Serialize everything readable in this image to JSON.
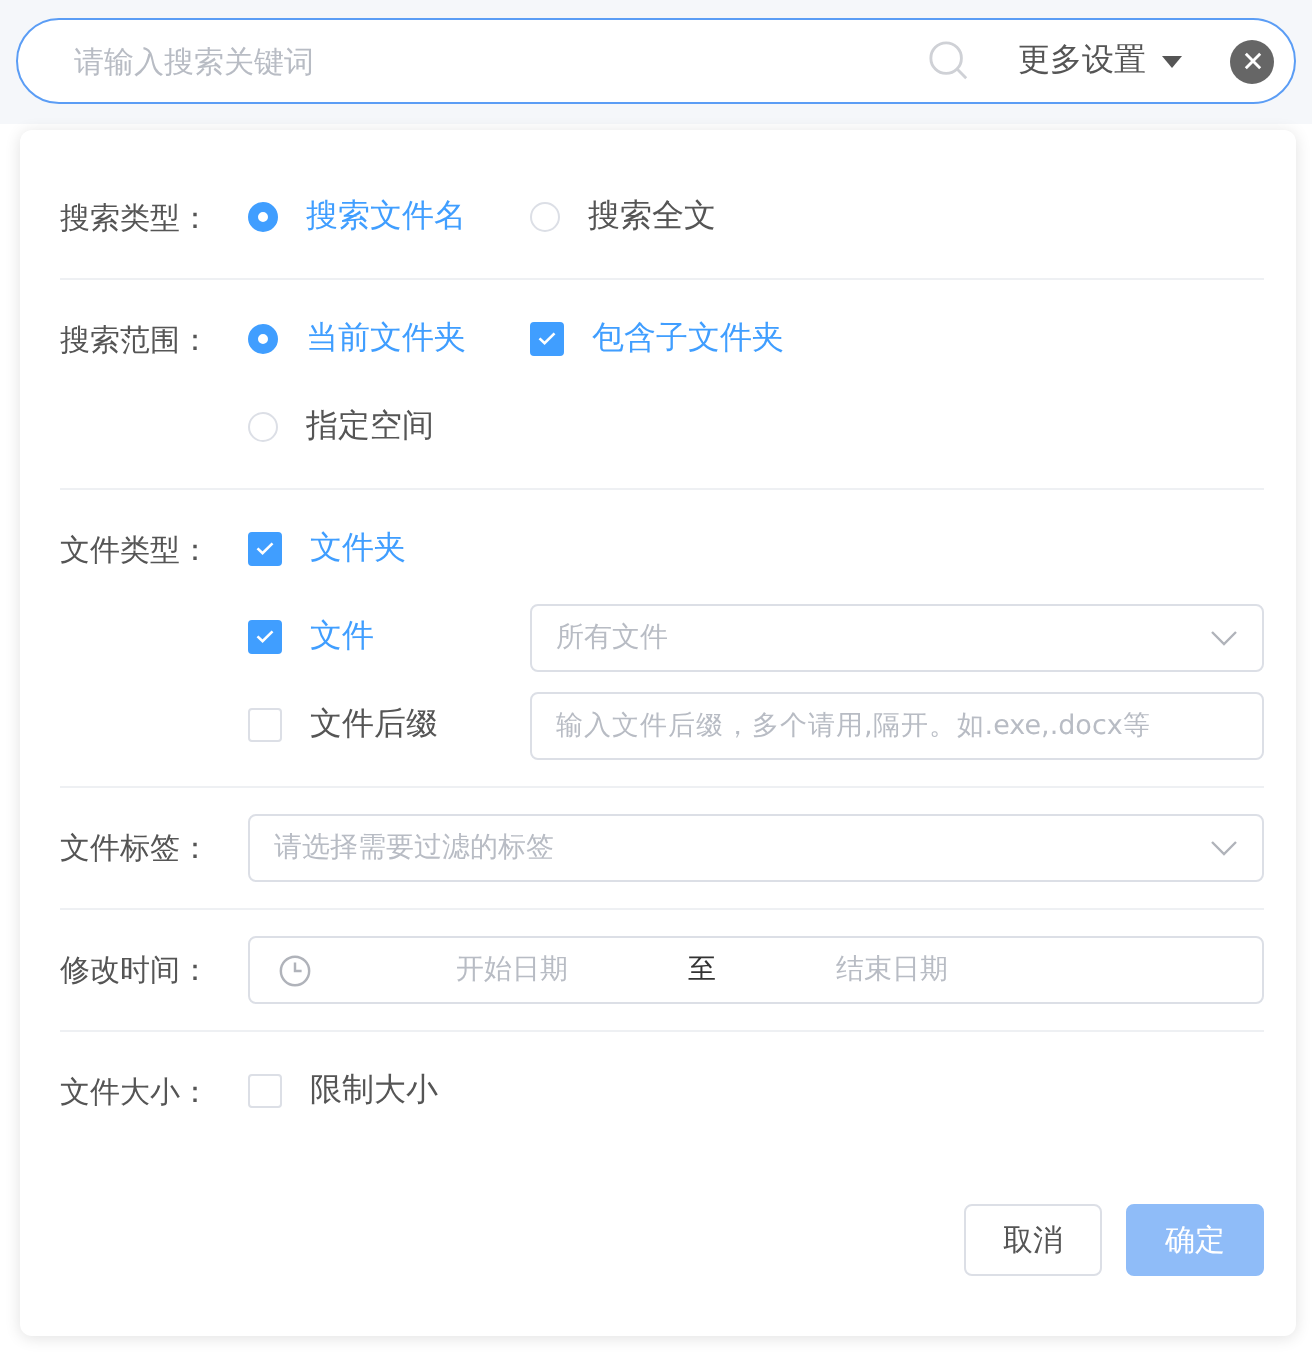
{
  "search": {
    "placeholder": "请输入搜索关键词",
    "more_settings": "更多设置"
  },
  "search_type": {
    "label": "搜索类型：",
    "options": [
      {
        "label": "搜索文件名",
        "selected": true
      },
      {
        "label": "搜索全文",
        "selected": false
      }
    ]
  },
  "search_scope": {
    "label": "搜索范围：",
    "options": [
      {
        "label": "当前文件夹",
        "selected": true
      },
      {
        "label": "指定空间",
        "selected": false
      }
    ],
    "include_subfolders": {
      "label": "包含子文件夹",
      "checked": true
    }
  },
  "file_type": {
    "label": "文件类型：",
    "items": [
      {
        "kind": "plain",
        "label": "文件夹",
        "checked": true
      },
      {
        "kind": "select",
        "label": "文件",
        "checked": true,
        "placeholder": "所有文件"
      },
      {
        "kind": "input",
        "label": "文件后缀",
        "checked": false,
        "placeholder": "输入文件后缀，多个请用,隔开。如.exe,.docx等"
      }
    ]
  },
  "file_tag": {
    "label": "文件标签：",
    "placeholder": "请选择需要过滤的标签"
  },
  "modified_time": {
    "label": "修改时间：",
    "start_placeholder": "开始日期",
    "separator": "至",
    "end_placeholder": "结束日期"
  },
  "file_size": {
    "label": "文件大小：",
    "limit": {
      "label": "限制大小",
      "checked": false
    }
  },
  "buttons": [
    {
      "kind": "default",
      "label": "取消",
      "disabled": false
    },
    {
      "kind": "primary",
      "label": "确定",
      "disabled": true
    }
  ]
}
